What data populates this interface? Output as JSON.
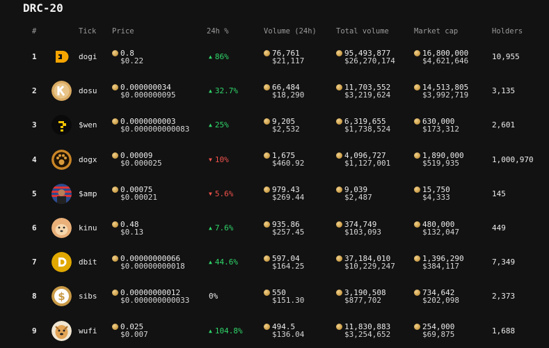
{
  "title": "DRC-20",
  "headers": {
    "rank": "#",
    "tick": "Tick",
    "price": "Price",
    "change": "24h %",
    "volume": "Volume (24h)",
    "total_volume": "Total volume",
    "market_cap": "Market cap",
    "holders": "Holders"
  },
  "rows": [
    {
      "rank": "1",
      "icon": "dogi-logo-icon",
      "tick": "dogi",
      "price": "0.8",
      "price_usd": "$0.22",
      "change": "86%",
      "dir": "up",
      "volume": "76,761",
      "volume_usd": "$21,117",
      "total_volume": "95,493,877",
      "total_volume_usd": "$26,270,174",
      "market_cap": "16,800,000",
      "market_cap_usd": "$4,621,646",
      "holders": "10,955"
    },
    {
      "rank": "2",
      "icon": "dosu-logo-icon",
      "tick": "dosu",
      "price": "0.000000034",
      "price_usd": "$0.000000095",
      "change": "32.7%",
      "dir": "up",
      "volume": "66,484",
      "volume_usd": "$18,290",
      "total_volume": "11,703,552",
      "total_volume_usd": "$3,219,624",
      "market_cap": "14,513,805",
      "market_cap_usd": "$3,992,719",
      "holders": "3,135"
    },
    {
      "rank": "3",
      "icon": "wen-logo-icon",
      "tick": "$wen",
      "price": "0.0000000003",
      "price_usd": "$0.000000000083",
      "change": "25%",
      "dir": "up",
      "volume": "9,205",
      "volume_usd": "$2,532",
      "total_volume": "6,319,655",
      "total_volume_usd": "$1,738,524",
      "market_cap": "630,000",
      "market_cap_usd": "$173,312",
      "holders": "2,601"
    },
    {
      "rank": "4",
      "icon": "dogx-logo-icon",
      "tick": "dogx",
      "price": "0.00009",
      "price_usd": "$0.000025",
      "change": "10%",
      "dir": "down",
      "volume": "1,675",
      "volume_usd": "$460.92",
      "total_volume": "4,096,727",
      "total_volume_usd": "$1,127,001",
      "market_cap": "1,890,000",
      "market_cap_usd": "$519,935",
      "holders": "1,000,970"
    },
    {
      "rank": "5",
      "icon": "amp-logo-icon",
      "tick": "$amp",
      "price": "0.00075",
      "price_usd": "$0.00021",
      "change": "5.6%",
      "dir": "down",
      "volume": "979.43",
      "volume_usd": "$269.44",
      "total_volume": "9,039",
      "total_volume_usd": "$2,487",
      "market_cap": "15,750",
      "market_cap_usd": "$4,333",
      "holders": "145"
    },
    {
      "rank": "6",
      "icon": "kinu-logo-icon",
      "tick": "kinu",
      "price": "0.48",
      "price_usd": "$0.13",
      "change": "7.6%",
      "dir": "up",
      "volume": "935.86",
      "volume_usd": "$257.45",
      "total_volume": "374,749",
      "total_volume_usd": "$103,093",
      "market_cap": "480,000",
      "market_cap_usd": "$132,047",
      "holders": "449"
    },
    {
      "rank": "7",
      "icon": "dbit-logo-icon",
      "tick": "dbit",
      "price": "0.00000000066",
      "price_usd": "$0.00000000018",
      "change": "44.6%",
      "dir": "up",
      "volume": "597.04",
      "volume_usd": "$164.25",
      "total_volume": "37,184,010",
      "total_volume_usd": "$10,229,247",
      "market_cap": "1,396,290",
      "market_cap_usd": "$384,117",
      "holders": "7,349"
    },
    {
      "rank": "8",
      "icon": "sibs-logo-icon",
      "tick": "sibs",
      "price": "0.00000000012",
      "price_usd": "$0.000000000033",
      "change": "0%",
      "dir": "neutral",
      "volume": "550",
      "volume_usd": "$151.30",
      "total_volume": "3,190,508",
      "total_volume_usd": "$877,702",
      "market_cap": "734,642",
      "market_cap_usd": "$202,098",
      "holders": "2,373"
    },
    {
      "rank": "9",
      "icon": "wufi-logo-icon",
      "tick": "wufi",
      "price": "0.025",
      "price_usd": "$0.007",
      "change": "104.8%",
      "dir": "up",
      "volume": "494.5",
      "volume_usd": "$136.04",
      "total_volume": "11,830,883",
      "total_volume_usd": "$3,254,652",
      "market_cap": "254,000",
      "market_cap_usd": "$69,875",
      "holders": "1,688"
    }
  ],
  "colors": {
    "up": "#2fd66a",
    "down": "#f0524c",
    "coin": "#d3a552",
    "background": "#121212"
  }
}
